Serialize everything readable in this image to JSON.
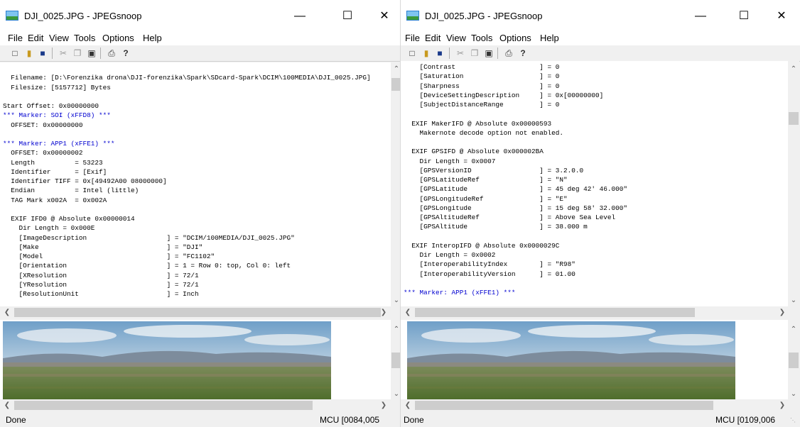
{
  "left": {
    "title": "DJI_0025.JPG - JPEGsnoop",
    "menu": [
      "File",
      "Edit",
      "View",
      "Tools",
      "Options",
      "Help"
    ],
    "lines": [
      {
        "t": "",
        "c": "k"
      },
      {
        "t": "  Filename: [D:\\Forenzika drona\\DJI-forenzika\\Spark\\SDcard-Spark\\DCIM\\100MEDIA\\DJI_0025.JPG]",
        "c": "k"
      },
      {
        "t": "  Filesize: [5157712] Bytes",
        "c": "k"
      },
      {
        "t": "",
        "c": "k"
      },
      {
        "t": "Start Offset: 0x00000000",
        "c": "k"
      },
      {
        "t": "*** Marker: SOI (xFFD8) ***",
        "c": "b"
      },
      {
        "t": "  OFFSET: 0x00000000",
        "c": "k"
      },
      {
        "t": "",
        "c": "k"
      },
      {
        "t": "*** Marker: APP1 (xFFE1) ***",
        "c": "b"
      },
      {
        "t": "  OFFSET: 0x00000002",
        "c": "k"
      },
      {
        "t": "  Length          = 53223",
        "c": "k"
      },
      {
        "t": "  Identifier      = [Exif]",
        "c": "k"
      },
      {
        "t": "  Identifier TIFF = 0x[49492A00 08000000]",
        "c": "k"
      },
      {
        "t": "  Endian          = Intel (little)",
        "c": "k"
      },
      {
        "t": "  TAG Mark x002A  = 0x002A",
        "c": "k"
      },
      {
        "t": "",
        "c": "k"
      },
      {
        "t": "  EXIF IFD0 @ Absolute 0x00000014",
        "c": "k"
      },
      {
        "t": "    Dir Length = 0x000E",
        "c": "k"
      },
      {
        "t": "    [ImageDescription                    ] = \"DCIM/100MEDIA/DJI_0025.JPG\"",
        "c": "k"
      },
      {
        "t": "    [Make                                ] = \"DJI\"",
        "c": "k"
      },
      {
        "t": "    [Model                               ] = \"FC1102\"",
        "c": "k"
      },
      {
        "t": "    [Orientation                         ] = 1 = Row 0: top, Col 0: left",
        "c": "k"
      },
      {
        "t": "    [XResolution                         ] = 72/1",
        "c": "k"
      },
      {
        "t": "    [YResolution                         ] = 72/1",
        "c": "k"
      },
      {
        "t": "    [ResolutionUnit                      ] = Inch",
        "c": "k"
      }
    ],
    "status_left": "Done",
    "status_right": "MCU [0084,005"
  },
  "right": {
    "title": "DJI_0025.JPG - JPEGsnoop",
    "menu": [
      "File",
      "Edit",
      "View",
      "Tools",
      "Options",
      "Help"
    ],
    "lines": [
      {
        "t": "    [Contrast                     ] = 0",
        "c": "k"
      },
      {
        "t": "    [Saturation                   ] = 0",
        "c": "k"
      },
      {
        "t": "    [Sharpness                    ] = 0",
        "c": "k"
      },
      {
        "t": "    [DeviceSettingDescription     ] = 0x[00000000]",
        "c": "k"
      },
      {
        "t": "    [SubjectDistanceRange         ] = 0",
        "c": "k"
      },
      {
        "t": "",
        "c": "k"
      },
      {
        "t": "  EXIF MakerIFD @ Absolute 0x00000593",
        "c": "k"
      },
      {
        "t": "    Makernote decode option not enabled.",
        "c": "k"
      },
      {
        "t": "",
        "c": "k"
      },
      {
        "t": "  EXIF GPSIFD @ Absolute 0x000002BA",
        "c": "k"
      },
      {
        "t": "    Dir Length = 0x0007",
        "c": "k"
      },
      {
        "t": "    [GPSVersionID                 ] = 3.2.0.0",
        "c": "k"
      },
      {
        "t": "    [GPSLatitudeRef               ] = \"N\"",
        "c": "k"
      },
      {
        "t": "    [GPSLatitude                  ] = 45 deg 42' 46.000\"",
        "c": "k"
      },
      {
        "t": "    [GPSLongitudeRef              ] = \"E\"",
        "c": "k"
      },
      {
        "t": "    [GPSLongitude                 ] = 15 deg 58' 32.000\"",
        "c": "k"
      },
      {
        "t": "    [GPSAltitudeRef               ] = Above Sea Level",
        "c": "k"
      },
      {
        "t": "    [GPSAltitude                  ] = 38.000 m",
        "c": "k"
      },
      {
        "t": "",
        "c": "k"
      },
      {
        "t": "  EXIF InteropIFD @ Absolute 0x0000029C",
        "c": "k"
      },
      {
        "t": "    Dir Length = 0x0002",
        "c": "k"
      },
      {
        "t": "    [InteroperabilityIndex        ] = \"R98\"",
        "c": "k"
      },
      {
        "t": "    [InteroperabilityVersion      ] = 01.00",
        "c": "k"
      },
      {
        "t": "",
        "c": "k"
      },
      {
        "t": "*** Marker: APP1 (xFFE1) ***",
        "c": "b"
      }
    ],
    "status_left": "Done",
    "status_right": "MCU [0109,006"
  },
  "window_controls": {
    "minimize": "—",
    "maximize": "☐",
    "close": "✕"
  },
  "toolbar_icons": [
    "new-icon",
    "open-icon",
    "save-icon",
    "cut-icon",
    "copy-icon",
    "paste-icon",
    "print-icon",
    "help-icon"
  ],
  "colors": {
    "marker_blue": "#0000d0",
    "titlebar": "#ffffff",
    "chrome": "#f0f0f0"
  }
}
